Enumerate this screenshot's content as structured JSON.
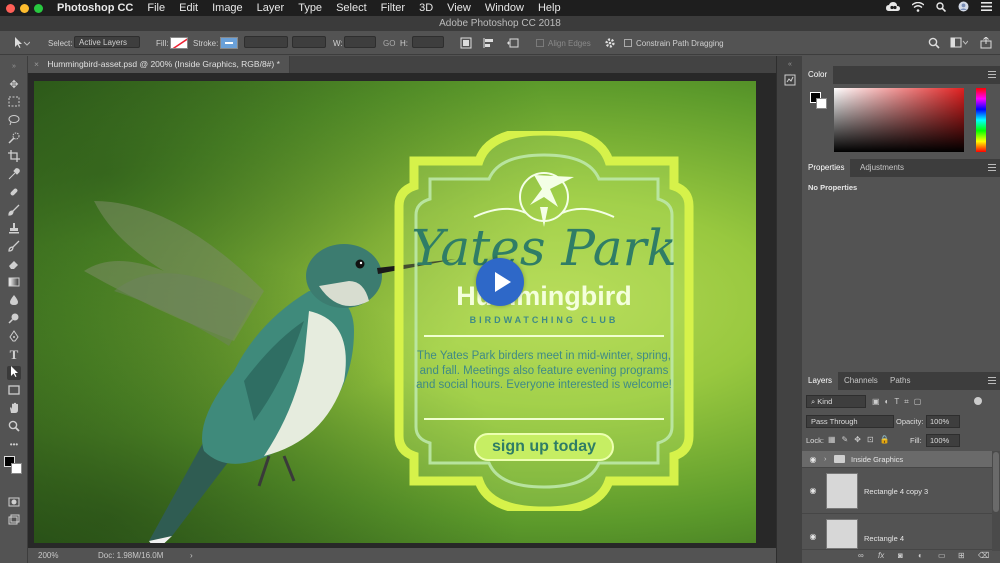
{
  "menubar": {
    "apple": "",
    "app": "Photoshop CC",
    "items": [
      "File",
      "Edit",
      "Image",
      "Layer",
      "Type",
      "Select",
      "Filter",
      "3D",
      "View",
      "Window",
      "Help"
    ],
    "traffic_colors": [
      "#fe5f57",
      "#febc2e",
      "#28c840"
    ]
  },
  "titlebar": {
    "title": "Adobe Photoshop CC 2018"
  },
  "options": {
    "select_label": "Select:",
    "select_value": "Active Layers",
    "fill_label": "Fill:",
    "stroke_label": "Stroke:",
    "w_label": "W:",
    "go_label": "GO",
    "h_label": "H:",
    "align_edges": "Align Edges",
    "constrain": "Constrain Path Dragging"
  },
  "document": {
    "tab_title": "Hummingbird-asset.psd @ 200% (Inside Graphics, RGB/8#) *",
    "close_glyph": "×"
  },
  "poster": {
    "headline": "Yates Park",
    "subtitle": "Hummingbird",
    "club": "BIRDWATCHING CLUB",
    "description": "The Yates Park birders meet in mid-winter, spring, and fall. Meetings also feature evening programs and social hours. Everyone interested is welcome!",
    "button": "sign up today",
    "colors": {
      "frame": "#d6f24a",
      "inner_line": "#bde8a8",
      "headline": "#2f7d66",
      "text": "#3f8a86"
    }
  },
  "video": {
    "play_color": "#2e68c8"
  },
  "statusbar": {
    "zoom": "200%",
    "doc": "Doc: 1.98M/16.0M",
    "arrow": "›"
  },
  "panels": {
    "color": {
      "tab": "Color"
    },
    "properties": {
      "tabs": [
        "Properties",
        "Adjustments"
      ],
      "message": "No Properties"
    },
    "layers": {
      "tabs": [
        "Layers",
        "Channels",
        "Paths"
      ],
      "filter": "Kind",
      "blend_mode": "Pass Through",
      "opacity_label": "Opacity:",
      "opacity_value": "100%",
      "lock_label": "Lock:",
      "fill_label": "Fill:",
      "fill_value": "100%",
      "items": [
        {
          "name": "Inside Graphics",
          "type": "group"
        },
        {
          "name": "Rectangle 4 copy 3",
          "type": "layer"
        },
        {
          "name": "Rectangle 4",
          "type": "layer"
        }
      ]
    }
  }
}
